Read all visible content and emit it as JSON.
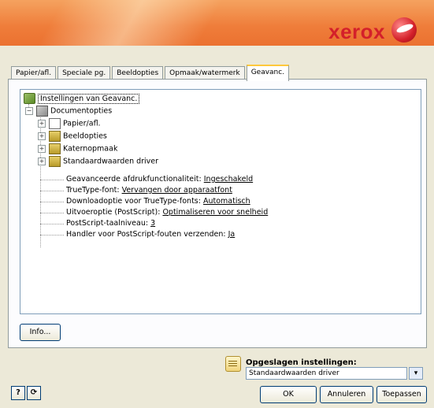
{
  "brand": {
    "name": "xerox"
  },
  "tabs": [
    {
      "label": "Papier/afl."
    },
    {
      "label": "Speciale pg."
    },
    {
      "label": "Beeldopties"
    },
    {
      "label": "Opmaak/watermerk"
    },
    {
      "label": "Geavanc."
    }
  ],
  "tree": {
    "root": "Instellingen van Geavanc.",
    "documentopties": "Documentopties",
    "children": [
      "Papier/afl.",
      "Beeldopties",
      "Katernopmaak",
      "Standaardwaarden driver"
    ],
    "settings": [
      {
        "label": "Geavanceerde afdrukfunctionaliteit:",
        "value": "Ingeschakeld"
      },
      {
        "label": "TrueType-font:",
        "value": "Vervangen door apparaatfont"
      },
      {
        "label": "Downloadoptie voor TrueType-fonts:",
        "value": "Automatisch"
      },
      {
        "label": "Uitvoeroptie (PostScript):",
        "value": "Optimaliseren voor snelheid"
      },
      {
        "label": "PostScript-taalniveau:",
        "value": "3"
      },
      {
        "label": "Handler voor PostScript-fouten verzenden:",
        "value": "Ja"
      }
    ]
  },
  "buttons": {
    "info": "Info...",
    "ok": "OK",
    "cancel": "Annuleren",
    "apply": "Toepassen",
    "help": "?"
  },
  "saved": {
    "label": "Opgeslagen instellingen:",
    "value": "Standaardwaarden driver"
  },
  "colors": {
    "banner": "#ef7d3a",
    "brand": "#d4202a",
    "active_tab_accent": "#ffc83c"
  }
}
